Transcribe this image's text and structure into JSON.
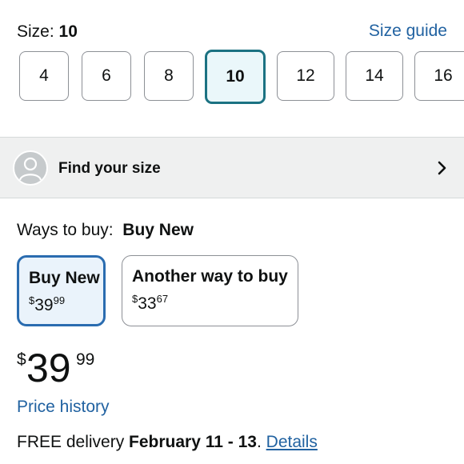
{
  "size": {
    "label": "Size:",
    "selected": "10",
    "guide_link": "Size guide",
    "options": [
      "4",
      "6",
      "8",
      "10",
      "12",
      "14",
      "16"
    ]
  },
  "find_size": {
    "label": "Find your size",
    "icons": {
      "avatar": "user-avatar-icon",
      "chevron": "chevron-right-icon"
    }
  },
  "ways_to_buy": {
    "label": "Ways to buy:",
    "selected": "Buy New",
    "options": [
      {
        "title": "Buy New",
        "currency": "$",
        "whole": "39",
        "fraction": "99"
      },
      {
        "title": "Another way to buy",
        "currency": "$",
        "whole": "33",
        "fraction": "67"
      }
    ]
  },
  "price": {
    "currency": "$",
    "whole": "39",
    "fraction": "99"
  },
  "price_history": "Price history",
  "delivery": {
    "prefix": "FREE delivery",
    "dates": "February 11 - 13",
    "period": ".",
    "details_link": "Details"
  },
  "colors": {
    "link": "#2162a1",
    "selected_size_border": "#1b7282",
    "selected_card_border": "#2a6cb0"
  }
}
